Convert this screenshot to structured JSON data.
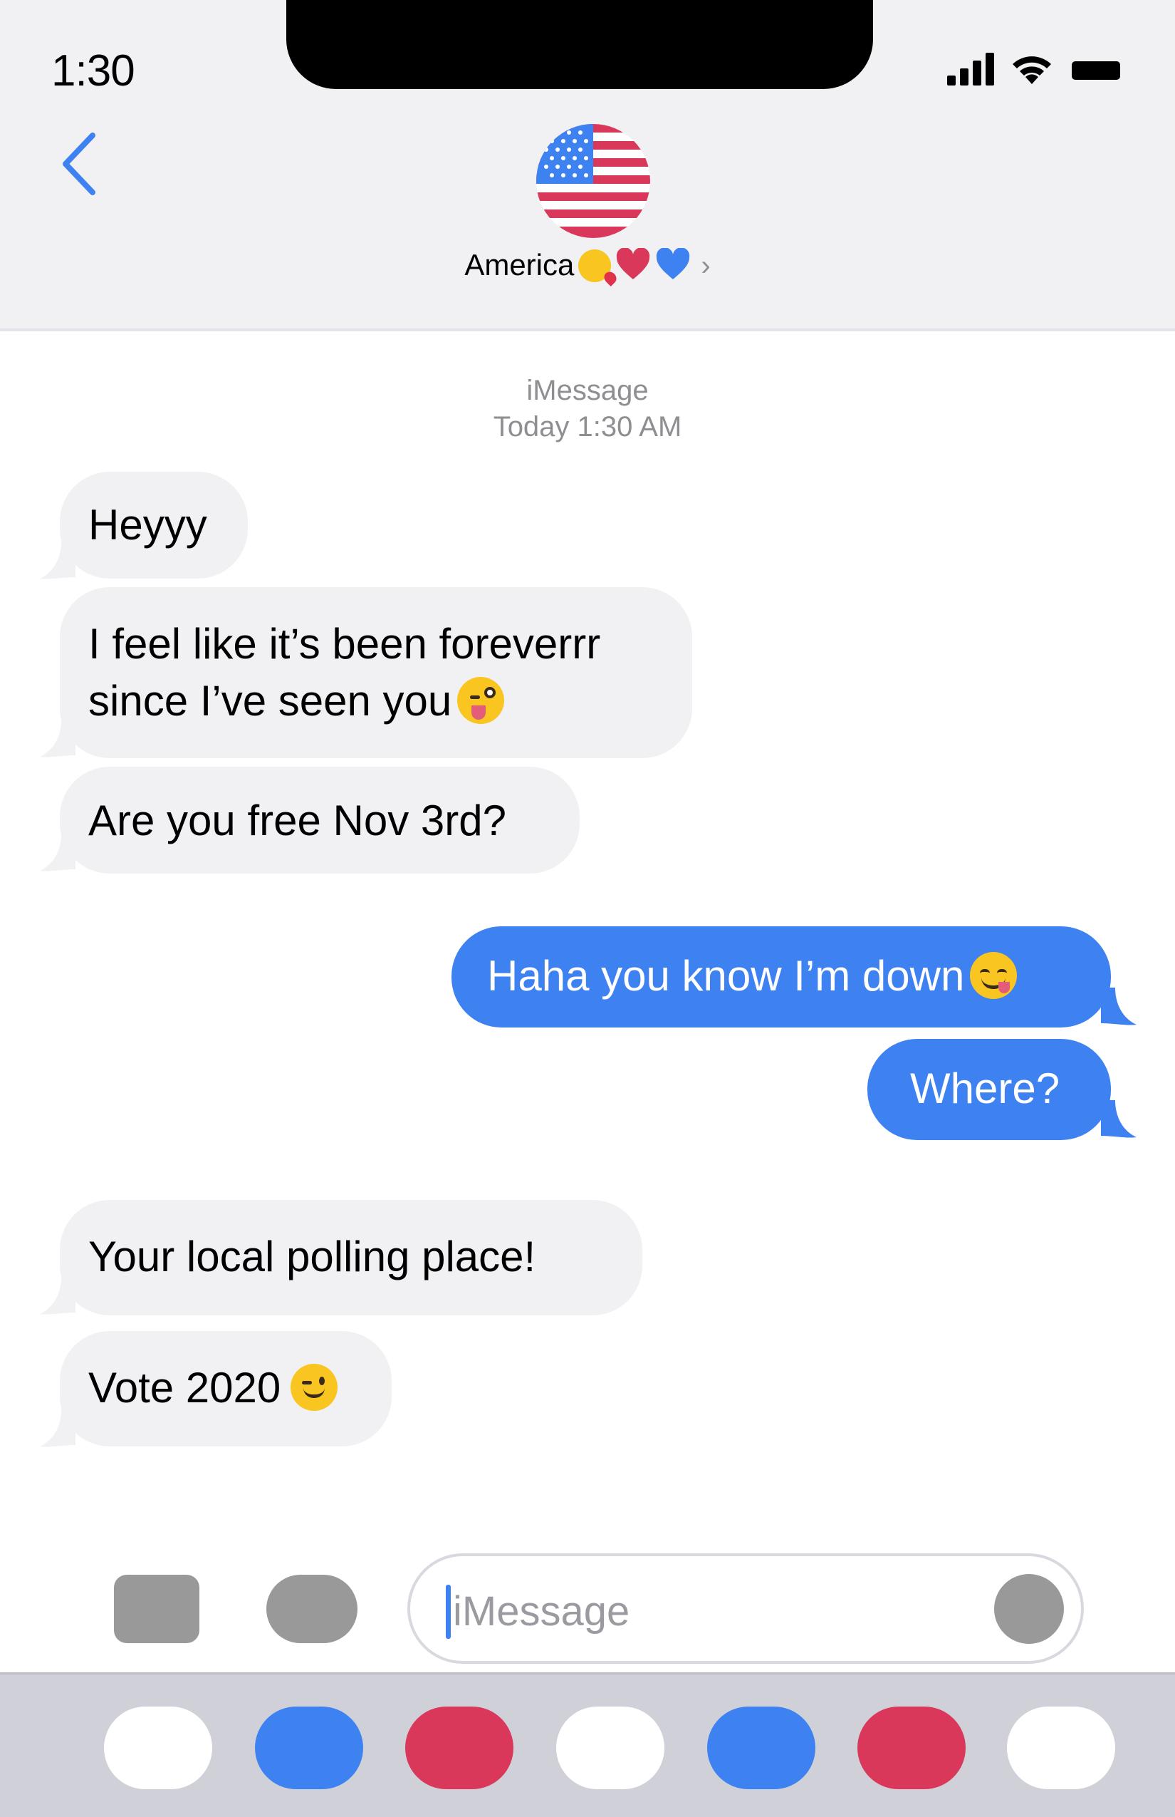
{
  "status_bar": {
    "time": "1:30"
  },
  "header": {
    "contact_name": "America"
  },
  "thread": {
    "service_label": "iMessage",
    "timestamp": "Today 1:30 AM",
    "messages": [
      {
        "direction": "in",
        "text": "Heyyy"
      },
      {
        "direction": "in",
        "line1": "I feel like it’s been foreverrr",
        "line2": "since I’ve seen you"
      },
      {
        "direction": "in",
        "text": "Are you free Nov 3rd?"
      },
      {
        "direction": "out",
        "text": "Haha you know I’m down"
      },
      {
        "direction": "out",
        "text": "Where?"
      },
      {
        "direction": "in",
        "text": "Your local polling place!"
      },
      {
        "direction": "in",
        "text": "Vote 2020"
      }
    ]
  },
  "input": {
    "placeholder": "iMessage"
  },
  "colors": {
    "bubble_out": "#3e82f1",
    "bubble_in": "#f1f0f3",
    "accent_red": "#d9385a",
    "accent_blue": "#3e82f1",
    "white": "#ffffff"
  },
  "icons": [
    "back-chevron-icon",
    "signal-icon",
    "wifi-icon",
    "battery-icon",
    "kiss-emoji-icon",
    "red-heart-icon",
    "blue-heart-icon",
    "chevron-right-icon",
    "winking-tongue-emoji-icon",
    "yum-emoji-icon",
    "wink-emoji-icon"
  ]
}
